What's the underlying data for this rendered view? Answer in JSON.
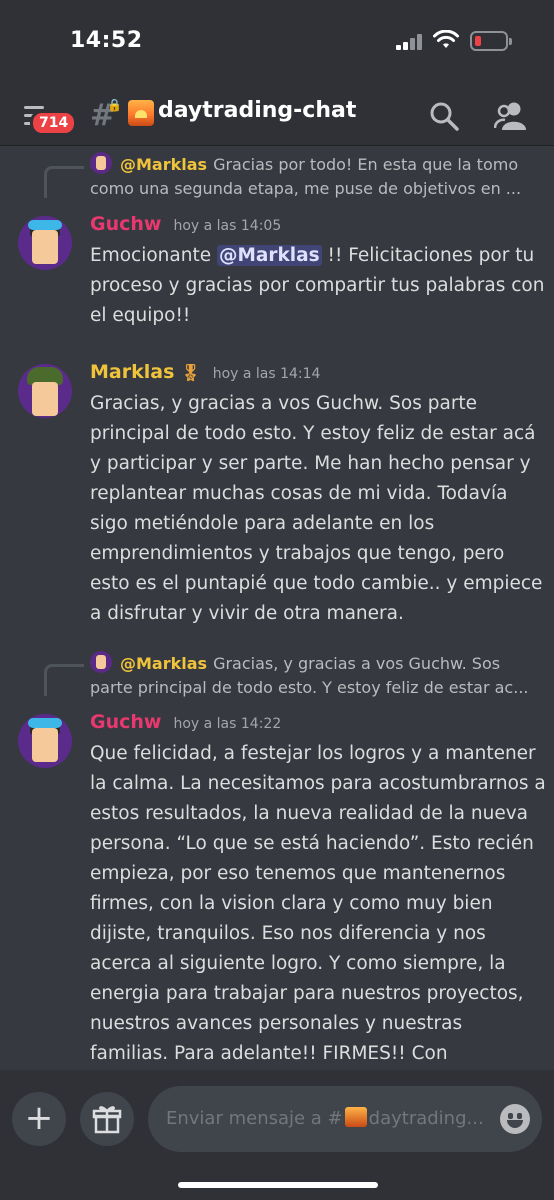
{
  "status_bar": {
    "time": "14:52"
  },
  "header": {
    "notification_count": "714",
    "channel_name": "daytrading-chat",
    "channel_icon": "hash-lock-icon",
    "channel_emoji": "sunrise-emoji"
  },
  "messages": [
    {
      "reply": {
        "author": "@Marklas",
        "text": "Gracias por todo! En esta que la tomo como una segunda etapa, me puse de objetivos en ..."
      },
      "author": "Guchw",
      "author_color": "#e8386f",
      "timestamp": "hoy a las 14:05",
      "body_before": "Emocionante ",
      "mention": "@Marklas",
      "body_after": " !! Felicitaciones por tu proceso y gracias por compartir tus palabras con el equipo!!"
    },
    {
      "author": "Marklas",
      "author_color": "#f0c33c",
      "role_icon": "medal-icon",
      "timestamp": "hoy a las 14:14",
      "body": "Gracias, y gracias a vos Guchw. Sos parte principal de todo esto. Y estoy feliz de estar acá y participar y ser parte. Me han hecho pensar y replantear muchas cosas de mi vida. Todavía sigo metiéndole para adelante en los emprendimientos y trabajos que tengo, pero esto es el puntapié que todo cambie.. y empiece a disfrutar y vivir de otra manera."
    },
    {
      "reply": {
        "author": "@Marklas",
        "text": "Gracias, y gracias a vos Guchw. Sos parte principal de todo esto. Y estoy feliz de estar ac..."
      },
      "author": "Guchw",
      "author_color": "#e8386f",
      "timestamp": "hoy a las 14:22",
      "body": "Que felicidad, a festejar los logros y a mantener la calma. La necesitamos para acostumbrarnos a estos resultados, la nueva realidad de la nueva persona. “Lo que se está haciendo”. Esto recién empieza, por eso tenemos que mantenernos firmes, con la vision clara y como muy bien dijiste, tranquilos. Eso nos diferencia y nos acerca al siguiente logro. Y como siempre, la energia para trabajar para nuestros proyectos, nuestros avances personales y nuestras familias. Para adelante!! FIRMES!! Con"
    }
  ],
  "composer": {
    "placeholder_prefix": "Enviar mensaje a #",
    "placeholder_channel": "daytrading..."
  }
}
